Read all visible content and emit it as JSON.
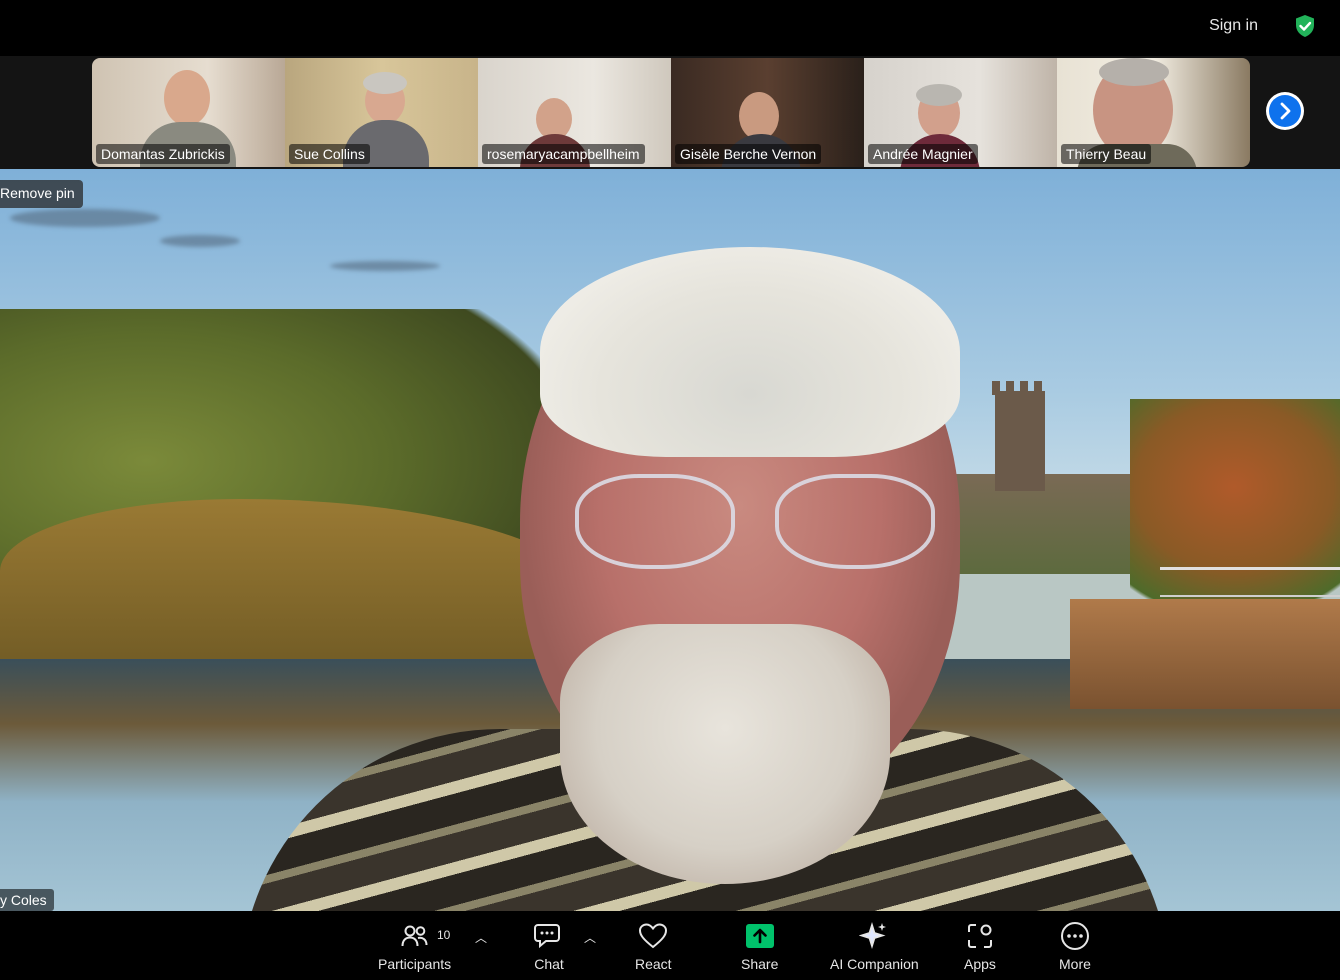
{
  "header": {
    "sign_in": "Sign in",
    "security_icon": "shield-check-icon",
    "accent": "#22b35a"
  },
  "gallery": {
    "participants": [
      {
        "name": "Domantas Zubrickis"
      },
      {
        "name": "Sue Collins"
      },
      {
        "name": "rosemaryacampbellheim"
      },
      {
        "name": "Gisèle Berche Vernon"
      },
      {
        "name": "Andrée Magnier"
      },
      {
        "name": "Thierry Beau"
      }
    ],
    "next_icon": "chevron-right-icon",
    "next_color": "#0e72ed"
  },
  "main": {
    "remove_pin": "Remove pin",
    "speaker_name": "y Coles"
  },
  "toolbar": {
    "participants_label": "Participants",
    "participants_count": "10",
    "chat_label": "Chat",
    "react_label": "React",
    "share_label": "Share",
    "share_color": "#00c26b",
    "ai_label": "AI Companion",
    "apps_label": "Apps",
    "more_label": "More"
  }
}
